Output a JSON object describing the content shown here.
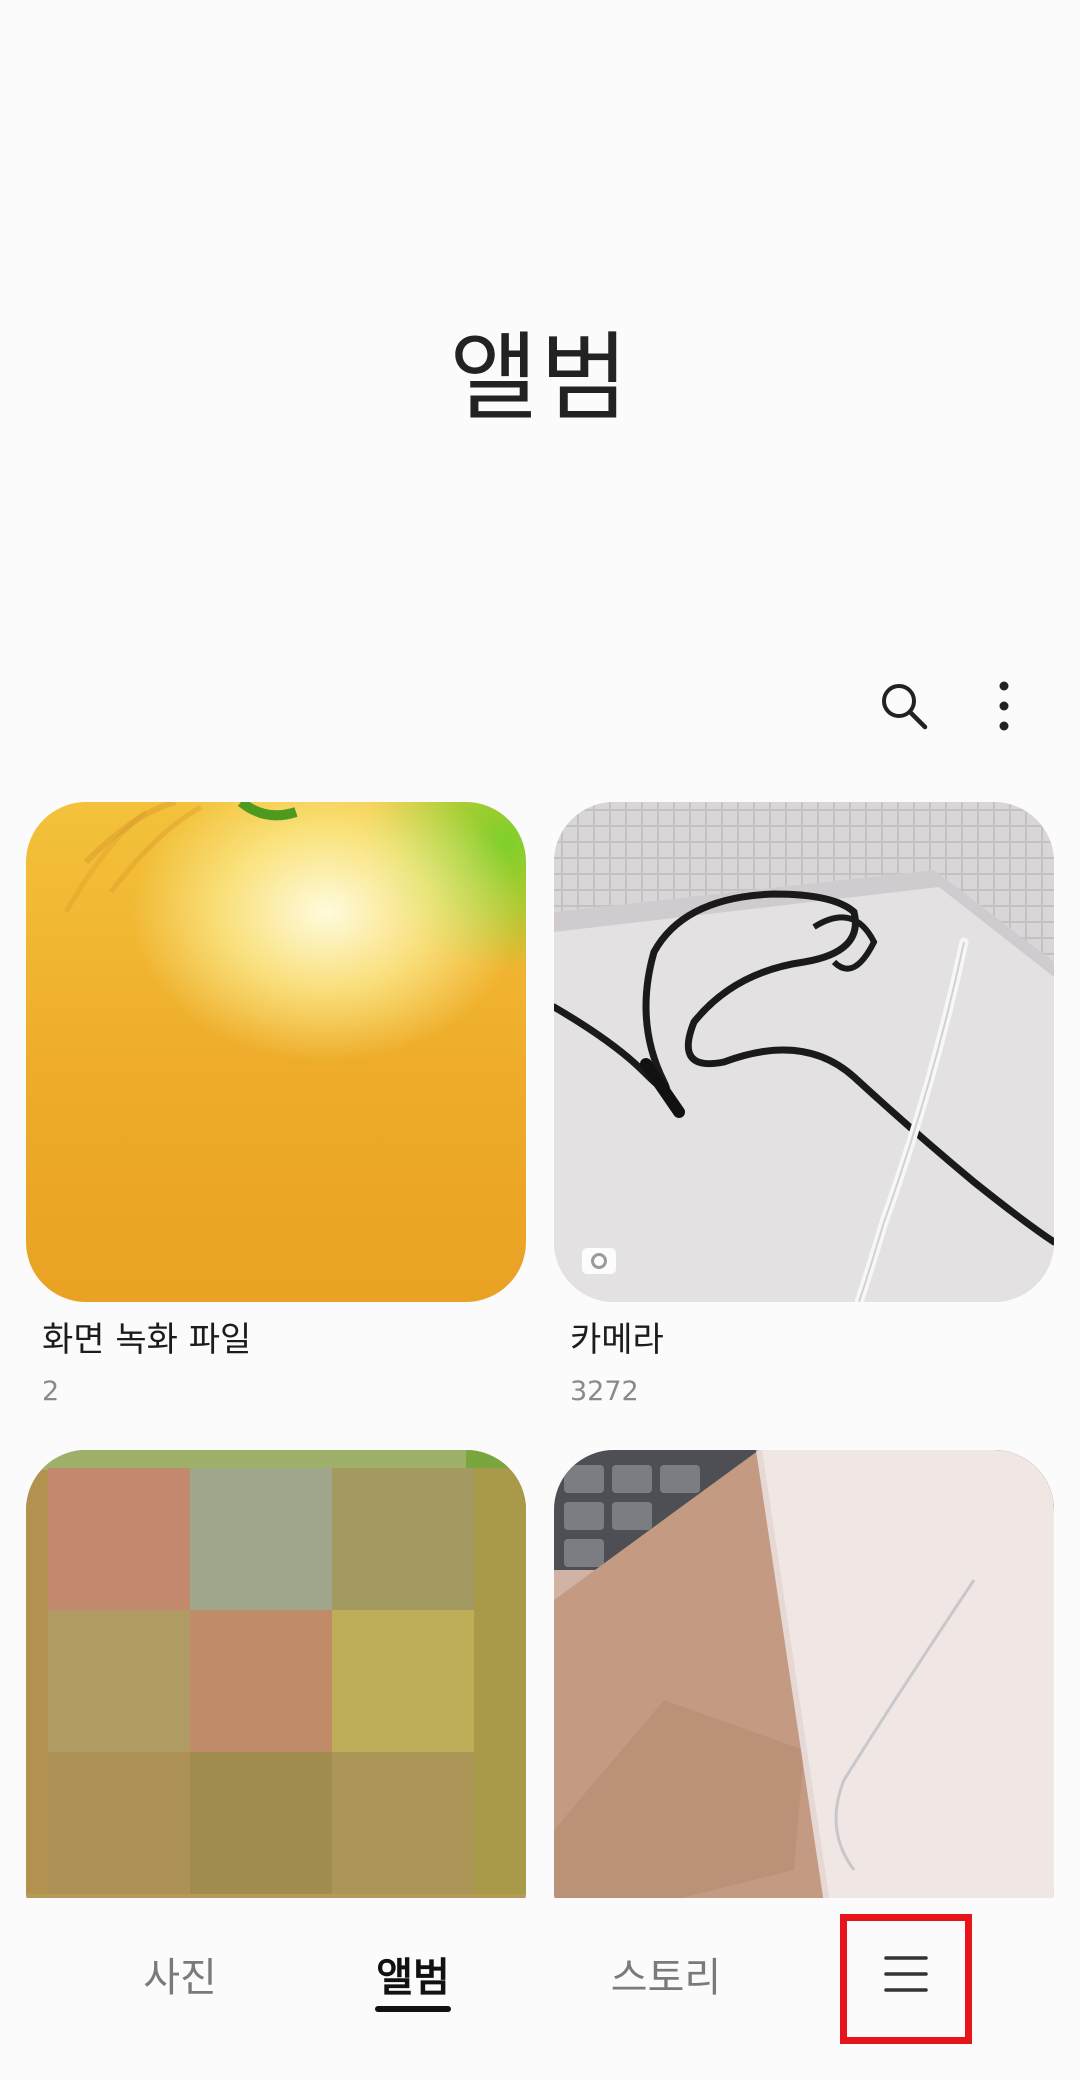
{
  "header": {
    "title": "앨범"
  },
  "toolbar": {
    "search_icon": "search-icon",
    "more_icon": "more-vertical-icon"
  },
  "albums": [
    {
      "name": "화면 녹화 파일",
      "count": "2",
      "thumbnail": "yellow-green gradient wallpaper"
    },
    {
      "name": "카메라",
      "count": "3272",
      "thumbnail": "black and white cables on white box",
      "badge": "camera-icon"
    },
    {
      "name": "",
      "count": "",
      "thumbnail": "pixelated mosaic image"
    },
    {
      "name": "",
      "count": "",
      "thumbnail": "beige face mask on keyboard"
    }
  ],
  "bottom_nav": {
    "items": [
      {
        "label": "사진",
        "active": false
      },
      {
        "label": "앨범",
        "active": true
      },
      {
        "label": "스토리",
        "active": false
      },
      {
        "label": "",
        "icon": "menu-icon"
      }
    ]
  },
  "colors": {
    "highlight": "#e8141c",
    "background": "#fbfbfb"
  }
}
